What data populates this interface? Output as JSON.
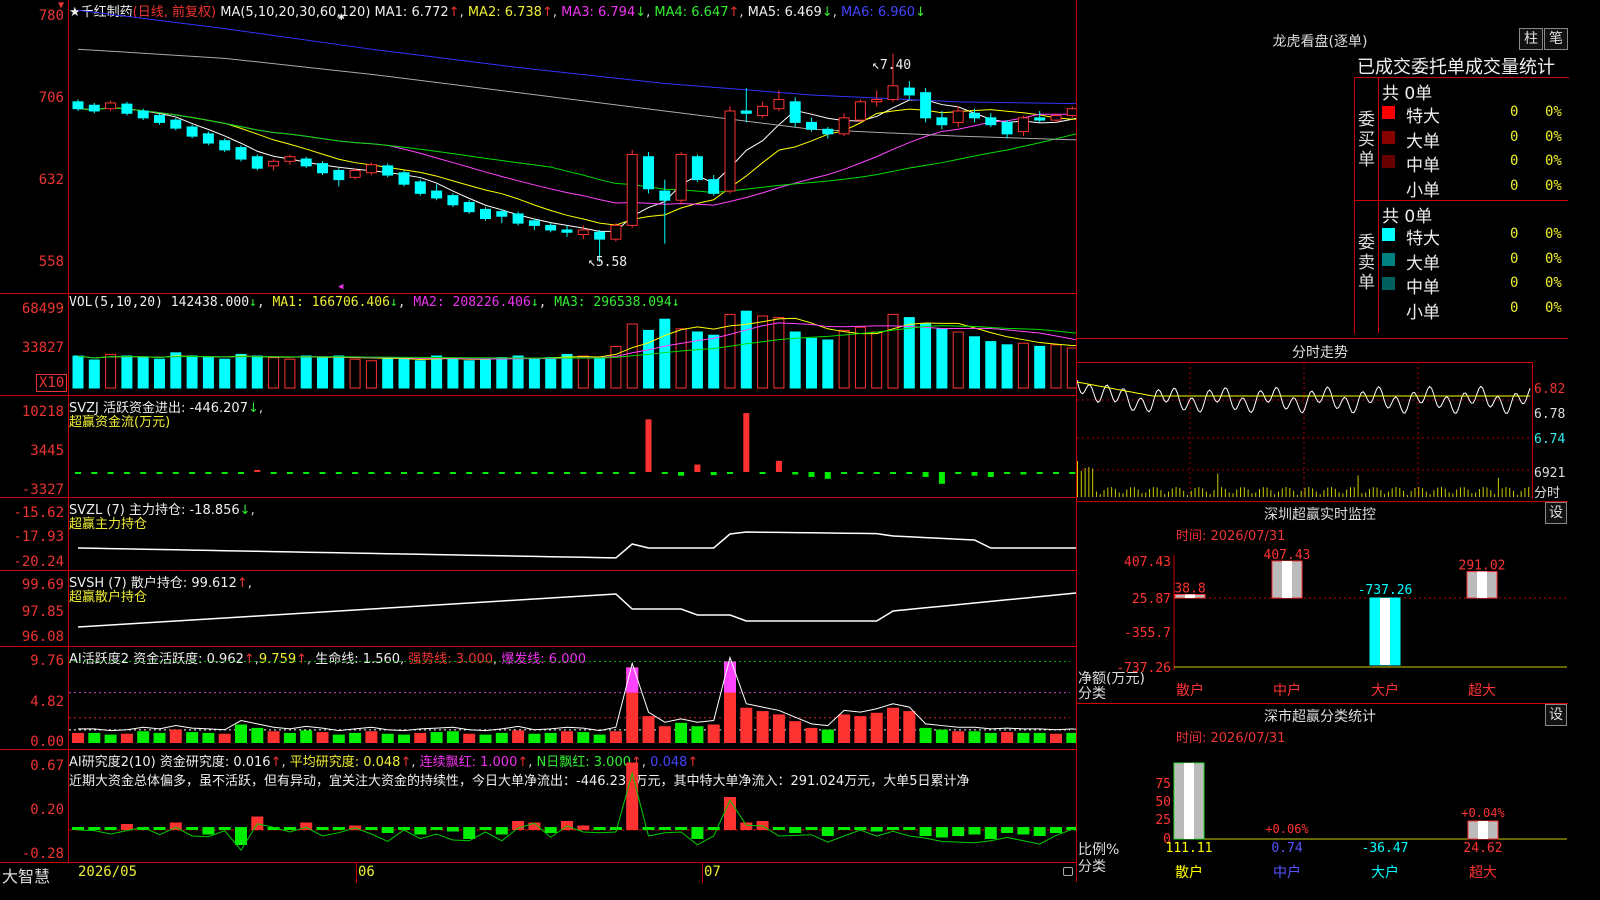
{
  "stock": {
    "name": "千红制药",
    "mode": "(日线, 前复权)"
  },
  "ma_header": {
    "label": "MA(5,10,20,30,60,120)",
    "ma1": "MA1: 6.772",
    "ma2": "MA2: 6.738",
    "ma3": "MA3: 6.794",
    "ma4": "MA4: 6.647",
    "ma5": "MA5: 6.469",
    "ma6": "MA6: 6.960"
  },
  "price_axis": [
    "780",
    "706",
    "632",
    "558"
  ],
  "price_annotations": {
    "high": "7.40",
    "low": "5.58"
  },
  "vol": {
    "header": "VOL(5,10,20)",
    "value": "142438.000",
    "ma1": "MA1: 166706.406",
    "ma2": "MA2: 208226.406",
    "ma3": "MA3: 296538.094",
    "axis": [
      "68499",
      "33827"
    ],
    "mult": "X10"
  },
  "svzj": {
    "header": "SVZJ  活跃资金进出: -446.207",
    "sub": "超赢资金流(万元)",
    "axis": [
      "10218",
      "3445",
      "-3327"
    ]
  },
  "svzl": {
    "header": "SVZL (7) 主力持仓: -18.856",
    "sub": "超赢主力持仓",
    "axis": [
      "-15.62",
      "-17.93",
      "-20.24"
    ]
  },
  "svsh": {
    "header": "SVSH (7) 散户持仓: 99.612",
    "sub": "超赢散户持仓",
    "axis": [
      "99.69",
      "97.85",
      "96.08"
    ]
  },
  "ai1": {
    "header": "AI活跃度2 资金活跃度: 0.962",
    "v2": "9.759",
    "life": "生命线: 1.560",
    "strong": "强势线: 3.000",
    "burst": "爆发线: 6.000",
    "axis": [
      "9.76",
      "4.82",
      "0.00"
    ]
  },
  "ai2": {
    "header": "AI研究度2(10) 资金研究度: 0.016",
    "avg": "平均研究度: 0.048",
    "cont": "连续飘红: 1.000",
    "nday": "N日飘红: 3.000",
    "v5": "0.048",
    "axis": [
      "0.67",
      "0.20",
      "-0.28"
    ],
    "commentary": "近期大资金总体偏多，虽不活跃，但有异动，宜关注大资金的持续性，今日大单净流出：-446.237万元，其中特大单净流入：291.024万元，大单5日累计净"
  },
  "bottom": {
    "brand": "大智慧",
    "dates": [
      "2026/05",
      "06",
      "07"
    ]
  },
  "right": {
    "lh_title": "龙虎看盘(逐单)",
    "btn_a": "柱",
    "btn_b": "笔",
    "table_title": "已成交委托单成交量统计",
    "buy": {
      "side": "委买单",
      "total": "共 0单",
      "rows": [
        {
          "label": "特大",
          "v": "0",
          "p": "0%",
          "color": "#ff0000"
        },
        {
          "label": "大单",
          "v": "0",
          "p": "0%",
          "color": "#880000"
        },
        {
          "label": "中单",
          "v": "0",
          "p": "0%",
          "color": "#660000"
        },
        {
          "label": "小单",
          "v": "0",
          "p": "0%",
          "color": "#000000"
        }
      ]
    },
    "sell": {
      "side": "委卖单",
      "total": "共 0单",
      "rows": [
        {
          "label": "特大",
          "v": "0",
          "p": "0%",
          "color": "#00ffff"
        },
        {
          "label": "大单",
          "v": "0",
          "p": "0%",
          "color": "#008080"
        },
        {
          "label": "中单",
          "v": "0",
          "p": "0%",
          "color": "#006060"
        },
        {
          "label": "小单",
          "v": "0",
          "p": "0%",
          "color": "#000000"
        }
      ]
    },
    "fs": {
      "title": "分时走势",
      "axis": [
        "6.82",
        "6.78",
        "6.74"
      ],
      "vol": "6921",
      "vol_lab": "分时"
    },
    "sz": {
      "title": "深圳超赢实时监控",
      "time": "时间: 2026/07/31",
      "set": "设",
      "axis": [
        "407.43",
        "25.87",
        "-355.7",
        "-737.26"
      ],
      "unit": "净额(万元)",
      "cls": "分类",
      "bars": [
        {
          "label": "散户",
          "value": 38.8,
          "vlabel": "38.8"
        },
        {
          "label": "中户",
          "value": 407.43,
          "vlabel": "407.43"
        },
        {
          "label": "大户",
          "value": -737.26,
          "vlabel": "-737.26"
        },
        {
          "label": "超大",
          "value": 291.02,
          "vlabel": "291.02"
        }
      ]
    },
    "cl": {
      "title": "深市超赢分类统计",
      "time": "时间: 2026/07/31",
      "set": "设",
      "axis": [
        "75",
        "50",
        "25",
        "0"
      ],
      "unit": "比例%",
      "cls": "分类",
      "bars": [
        {
          "label": "散户",
          "pct": "",
          "value": 111.11,
          "vlabel": "111.11"
        },
        {
          "label": "中户",
          "pct": "+0.06%",
          "value": 0.74,
          "vlabel": "0.74"
        },
        {
          "label": "大户",
          "pct": "",
          "value": -36.47,
          "vlabel": "-36.47"
        },
        {
          "label": "超大",
          "pct": "+0.04%",
          "value": 24.62,
          "vlabel": "24.62"
        }
      ]
    }
  },
  "chart_data": {
    "type": "candlestick",
    "candles": [
      [
        6.98,
        6.92,
        7.0,
        6.9
      ],
      [
        6.95,
        6.9,
        6.97,
        6.88
      ],
      [
        6.92,
        6.97,
        6.99,
        6.9
      ],
      [
        6.96,
        6.88,
        6.98,
        6.86
      ],
      [
        6.9,
        6.84,
        6.92,
        6.82
      ],
      [
        6.86,
        6.8,
        6.88,
        6.78
      ],
      [
        6.82,
        6.75,
        6.84,
        6.73
      ],
      [
        6.76,
        6.68,
        6.78,
        6.66
      ],
      [
        6.7,
        6.62,
        6.72,
        6.6
      ],
      [
        6.64,
        6.56,
        6.66,
        6.54
      ],
      [
        6.58,
        6.48,
        6.6,
        6.46
      ],
      [
        6.5,
        6.4,
        6.52,
        6.38
      ],
      [
        6.42,
        6.46,
        6.48,
        6.38
      ],
      [
        6.46,
        6.5,
        6.52,
        6.43
      ],
      [
        6.48,
        6.42,
        6.5,
        6.4
      ],
      [
        6.44,
        6.36,
        6.46,
        6.34
      ],
      [
        6.38,
        6.3,
        6.4,
        6.24
      ],
      [
        6.32,
        6.38,
        6.4,
        6.3
      ],
      [
        6.36,
        6.43,
        6.45,
        6.34
      ],
      [
        6.42,
        6.34,
        6.44,
        6.32
      ],
      [
        6.36,
        6.26,
        6.38,
        6.24
      ],
      [
        6.28,
        6.18,
        6.3,
        6.16
      ],
      [
        6.2,
        6.14,
        6.26,
        6.12
      ],
      [
        6.16,
        6.08,
        6.18,
        6.06
      ],
      [
        6.1,
        6.02,
        6.12,
        6.0
      ],
      [
        6.04,
        5.96,
        6.06,
        5.94
      ],
      [
        6.02,
        5.98,
        6.04,
        5.92
      ],
      [
        6.0,
        5.92,
        6.02,
        5.9
      ],
      [
        5.94,
        5.9,
        5.96,
        5.86
      ],
      [
        5.9,
        5.86,
        5.92,
        5.84
      ],
      [
        5.86,
        5.84,
        5.9,
        5.8
      ],
      [
        5.82,
        5.86,
        5.9,
        5.78
      ],
      [
        5.84,
        5.78,
        5.86,
        5.58
      ],
      [
        5.78,
        5.9,
        5.92,
        5.76
      ],
      [
        5.9,
        6.52,
        6.56,
        5.88
      ],
      [
        6.5,
        6.22,
        6.54,
        6.18
      ],
      [
        6.2,
        6.12,
        6.3,
        5.74
      ],
      [
        6.12,
        6.52,
        6.54,
        6.08
      ],
      [
        6.5,
        6.3,
        6.52,
        6.28
      ],
      [
        6.3,
        6.18,
        6.34,
        6.16
      ],
      [
        6.2,
        6.9,
        6.94,
        6.18
      ],
      [
        6.9,
        6.88,
        7.1,
        6.8
      ],
      [
        6.86,
        6.94,
        6.98,
        6.84
      ],
      [
        6.92,
        7.0,
        7.08,
        6.9
      ],
      [
        6.98,
        6.8,
        7.02,
        6.76
      ],
      [
        6.8,
        6.74,
        6.84,
        6.72
      ],
      [
        6.74,
        6.7,
        6.76,
        6.66
      ],
      [
        6.7,
        6.84,
        6.88,
        6.68
      ],
      [
        6.82,
        6.98,
        7.0,
        6.8
      ],
      [
        6.98,
        7.0,
        7.08,
        6.94
      ],
      [
        7.0,
        7.12,
        7.4,
        6.98
      ],
      [
        7.1,
        7.04,
        7.16,
        7.0
      ],
      [
        7.06,
        6.84,
        7.1,
        6.8
      ],
      [
        6.84,
        6.78,
        6.9,
        6.74
      ],
      [
        6.8,
        6.9,
        6.94,
        6.76
      ],
      [
        6.88,
        6.84,
        6.92,
        6.8
      ],
      [
        6.84,
        6.78,
        6.88,
        6.76
      ],
      [
        6.8,
        6.7,
        6.82,
        6.66
      ],
      [
        6.72,
        6.84,
        6.86,
        6.68
      ],
      [
        6.84,
        6.82,
        6.9,
        6.8
      ],
      [
        6.82,
        6.86,
        6.88,
        6.8
      ],
      [
        6.86,
        6.92,
        6.94,
        6.84
      ],
      [
        6.92,
        6.88,
        6.96,
        6.86
      ],
      [
        6.88,
        6.96,
        6.98,
        6.86
      ]
    ],
    "volume": [
      40,
      35,
      42,
      40,
      38,
      36,
      44,
      40,
      38,
      36,
      42,
      40,
      38,
      36,
      40,
      38,
      40,
      36,
      34,
      38,
      36,
      34,
      40,
      36,
      34,
      36,
      38,
      40,
      36,
      38,
      42,
      40,
      38,
      52,
      80,
      72,
      86,
      74,
      70,
      66,
      92,
      96,
      90,
      88,
      70,
      62,
      60,
      72,
      76,
      70,
      92,
      88,
      80,
      74,
      70,
      64,
      58,
      54,
      56,
      52,
      54,
      50,
      48,
      44
    ],
    "svzj": [
      -80,
      -60,
      -40,
      -70,
      -120,
      -150,
      -90,
      -130,
      -200,
      -300,
      -100,
      200,
      -50,
      -80,
      -120,
      -90,
      -60,
      -40,
      -80,
      -120,
      -100,
      -70,
      -50,
      -60,
      -90,
      -80,
      -60,
      -40,
      -60,
      -80,
      -100,
      -60,
      -80,
      -60,
      -70,
      8500,
      -300,
      -600,
      1200,
      -500,
      -200,
      9500,
      -200,
      1800,
      -400,
      -800,
      -1100,
      -300,
      -200,
      -100,
      -300,
      -200,
      -800,
      -1900,
      -200,
      -600,
      -800,
      -300,
      -400,
      -200,
      -100,
      -300,
      -200,
      -200
    ],
    "ai_active": [
      1.2,
      1.2,
      1.0,
      1.1,
      1.4,
      1.2,
      1.6,
      1.3,
      1.2,
      1.1,
      2.2,
      1.8,
      1.4,
      1.2,
      1.5,
      1.3,
      1.0,
      1.2,
      1.4,
      1.1,
      1.0,
      1.2,
      1.3,
      1.4,
      1.1,
      1.0,
      1.2,
      1.5,
      1.1,
      1.2,
      1.4,
      1.3,
      1.0,
      1.4,
      9.0,
      3.2,
      2.0,
      2.4,
      2.0,
      2.2,
      9.7,
      4.2,
      3.8,
      3.4,
      2.6,
      1.8,
      1.6,
      3.4,
      3.2,
      3.6,
      4.2,
      3.8,
      1.8,
      1.6,
      1.4,
      1.4,
      1.2,
      1.3,
      1.2,
      1.2,
      1.1,
      1.2,
      1.0,
      1.0
    ],
    "ai_research": [
      0.0,
      0.01,
      0.0,
      0.04,
      0.02,
      -0.02,
      0.05,
      0.0,
      -0.05,
      0.01,
      -0.12,
      0.09,
      0.02,
      0.0,
      0.05,
      0.0,
      -0.02,
      0.03,
      0.0,
      -0.04,
      0.0,
      -0.05,
      0.0,
      -0.03,
      -0.08,
      0.0,
      -0.05,
      0.06,
      0.05,
      -0.04,
      0.06,
      0.03,
      -0.02,
      0.0,
      0.45,
      0.0,
      -0.02,
      0.0,
      -0.08,
      0.0,
      0.22,
      0.05,
      0.06,
      0.0,
      -0.04,
      -0.02,
      -0.06,
      0.0,
      0.0,
      -0.03,
      0.02,
      0.0,
      -0.06,
      -0.07,
      -0.06,
      -0.05,
      -0.08,
      -0.04,
      -0.05,
      -0.06,
      -0.04,
      0.02,
      0.0,
      0.02
    ]
  }
}
